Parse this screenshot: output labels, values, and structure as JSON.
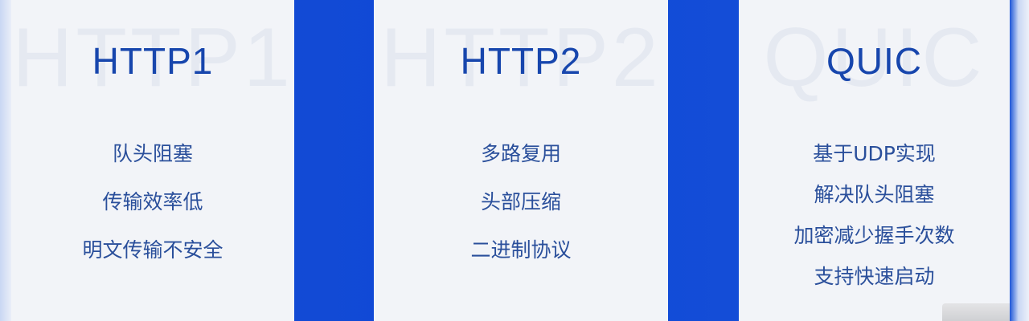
{
  "cards": [
    {
      "title": "HTTP1",
      "features": [
        "队头阻塞",
        "传输效率低",
        "明文传输不安全"
      ]
    },
    {
      "title": "HTTP2",
      "features": [
        "多路复用",
        "头部压缩",
        "二进制协议"
      ]
    },
    {
      "title": "QUIC",
      "features": [
        "基于UDP实现",
        "解决队头阻塞",
        "加密减少握手次数",
        "支持快速启动"
      ]
    }
  ],
  "colors": {
    "background_blue": "#0d47d8",
    "card_bg": "#f2f4f8",
    "title_blue": "#1746ad",
    "text_blue": "#2a4f9b",
    "watermark": "#e5e9f1"
  }
}
